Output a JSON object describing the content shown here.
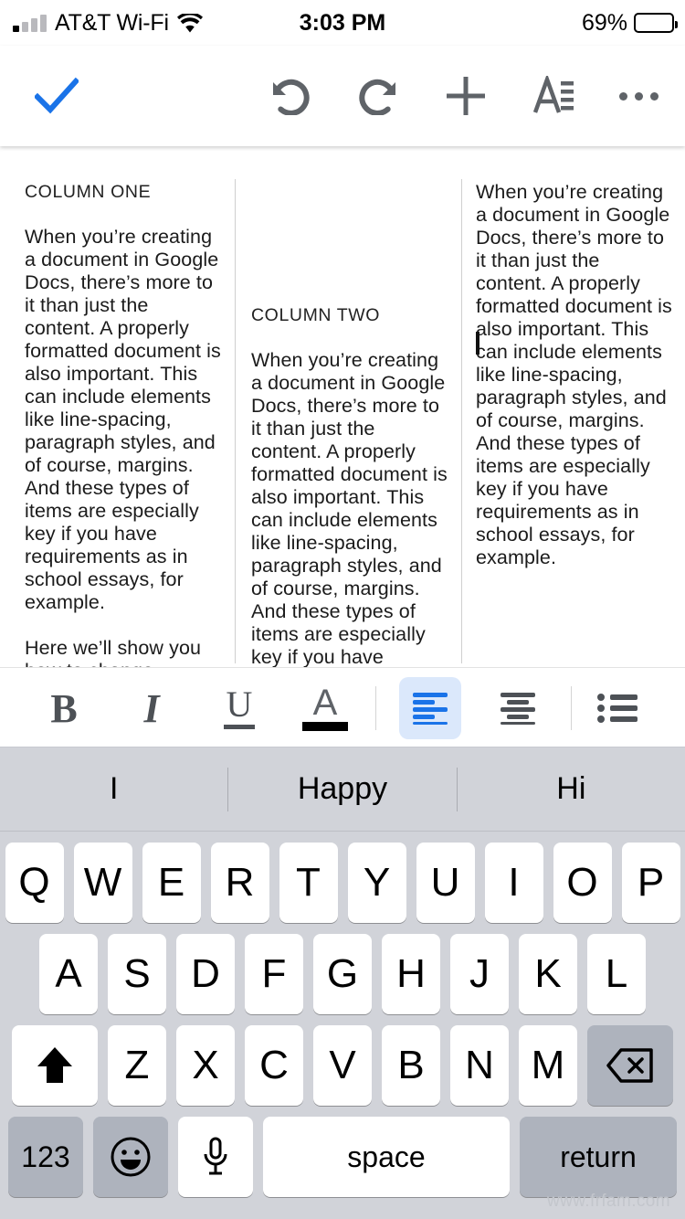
{
  "status_bar": {
    "carrier": "AT&T Wi-Fi",
    "time": "3:03 PM",
    "battery_percent": "69%",
    "signal_icon": "signal-bars-icon",
    "wifi_icon": "wifi-icon",
    "battery_icon": "battery-icon"
  },
  "toolbar": {
    "done_label": "done-checkmark",
    "accent_color": "#1a73e8",
    "icon_color": "#5f6368",
    "items": [
      {
        "name": "done-check-icon",
        "label": "Done"
      },
      {
        "name": "undo-icon",
        "label": "Undo"
      },
      {
        "name": "redo-icon",
        "label": "Redo"
      },
      {
        "name": "add-icon",
        "label": "Insert"
      },
      {
        "name": "format-text-icon",
        "label": "Format"
      },
      {
        "name": "more-options-icon",
        "label": "More"
      }
    ]
  },
  "document": {
    "columns": [
      {
        "heading": "COLUMN ONE",
        "paragraphs": [
          "When you’re creating a document in Google Docs, there’s more to it than just the content. A properly formatted document is also important. This can include elements like line-spacing, paragraph styles, and of course, margins. And these types of items are especially key if you have requirements as in school essays, for example.",
          "Here we’ll show you how to change margins in Google Docs both online and in the mobile app."
        ]
      },
      {
        "heading": "COLUMN TWO",
        "paragraphs": [
          "When you’re creating a document in Google Docs, there’s more to it than just the content. A properly formatted document is also important. This can include elements like line-spacing, paragraph styles, and of course, margins. And these types of items are especially key if you have requirements as in school essays, for example."
        ]
      },
      {
        "heading": "",
        "paragraphs": [
          "When you’re creating a document in Google Docs, there’s more to it than just the content. A properly formatted document is also important. This can include elements like line-spacing, paragraph styles, and of course, margins. And these types of items are especially key if you have requirements as in school essays, for example."
        ]
      }
    ],
    "cursor_visible": true
  },
  "format_bar": {
    "active_color": "#1a73e8",
    "active_bg": "#dbe8fb",
    "text_color_swatch": "#000000",
    "buttons": [
      {
        "name": "bold-button",
        "glyph": "B",
        "active": false
      },
      {
        "name": "italic-button",
        "glyph": "I",
        "active": false
      },
      {
        "name": "underline-button",
        "glyph": "U",
        "active": false
      },
      {
        "name": "text-color-button",
        "glyph": "A",
        "active": false
      },
      {
        "name": "align-left-button",
        "glyph": "align-left-icon",
        "active": true
      },
      {
        "name": "align-center-button",
        "glyph": "align-center-icon",
        "active": false
      },
      {
        "name": "bulleted-list-button",
        "glyph": "bulleted-list-icon",
        "active": false
      }
    ]
  },
  "keyboard": {
    "predictions": [
      "I",
      "Happy",
      "Hi"
    ],
    "row1": [
      "Q",
      "W",
      "E",
      "R",
      "T",
      "Y",
      "U",
      "I",
      "O",
      "P"
    ],
    "row2": [
      "A",
      "S",
      "D",
      "F",
      "G",
      "H",
      "J",
      "K",
      "L"
    ],
    "row3": [
      "Z",
      "X",
      "C",
      "V",
      "B",
      "N",
      "M"
    ],
    "shift_key": "shift-icon",
    "backspace_key": "backspace-icon",
    "numbers_key": "123",
    "emoji_key": "emoji-icon",
    "dictation_key": "microphone-icon",
    "space_key": "space",
    "return_key": "return"
  },
  "watermark": "www.frfam.com"
}
